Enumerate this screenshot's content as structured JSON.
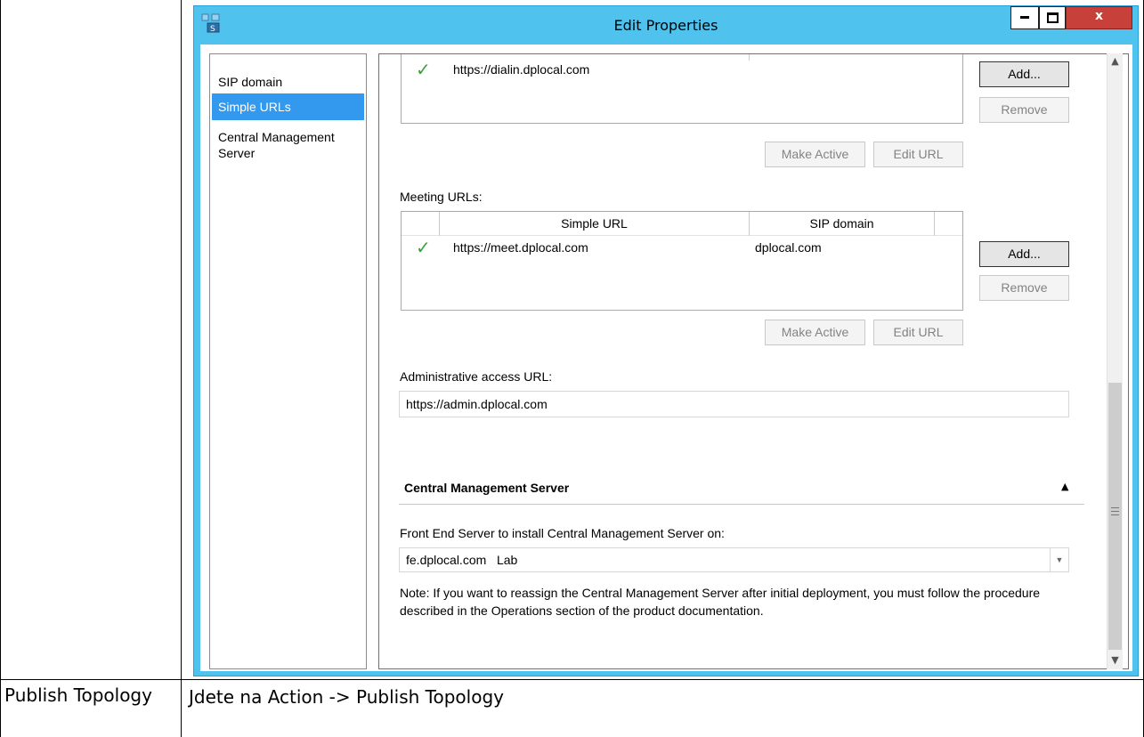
{
  "window": {
    "title": "Edit Properties",
    "min_glyph": "▬",
    "max_glyph": "☐",
    "close_glyph": "x"
  },
  "nav": {
    "items": [
      {
        "label": "SIP domain"
      },
      {
        "label": "Simple URLs",
        "selected": true
      },
      {
        "label": "Central Management\nServer"
      }
    ]
  },
  "dialin": {
    "rows": [
      {
        "url": "https://dialin.dplocal.com",
        "sip_domain": ""
      }
    ],
    "add_label": "Add...",
    "remove_label": "Remove",
    "make_active_label": "Make Active",
    "edit_url_label": "Edit URL"
  },
  "meeting": {
    "label": "Meeting URLs:",
    "columns": [
      "Simple URL",
      "SIP domain"
    ],
    "rows": [
      {
        "url": "https://meet.dplocal.com",
        "sip_domain": "dplocal.com"
      }
    ],
    "add_label": "Add...",
    "remove_label": "Remove",
    "make_active_label": "Make Active",
    "edit_url_label": "Edit URL"
  },
  "admin": {
    "label": "Administrative access URL:",
    "value": "https://admin.dplocal.com"
  },
  "cms": {
    "section_title": "Central Management Server",
    "collapse_glyph": "▲",
    "fe_label": "Front End Server to install Central Management Server on:",
    "fe_value": "fe.dplocal.com   Lab",
    "note": "Note: If you want to reassign the Central Management Server after initial deployment, you must follow the procedure described in the Operations section of the product documentation."
  },
  "doc": {
    "left_cell": "Publish Topology",
    "right_cell": "Jdete na Action -> Publish Topology"
  },
  "colors": {
    "title_bar": "#4fc3ee",
    "selection": "#3399ee",
    "check": "#3aa43a",
    "close_button": "#c7403a"
  }
}
